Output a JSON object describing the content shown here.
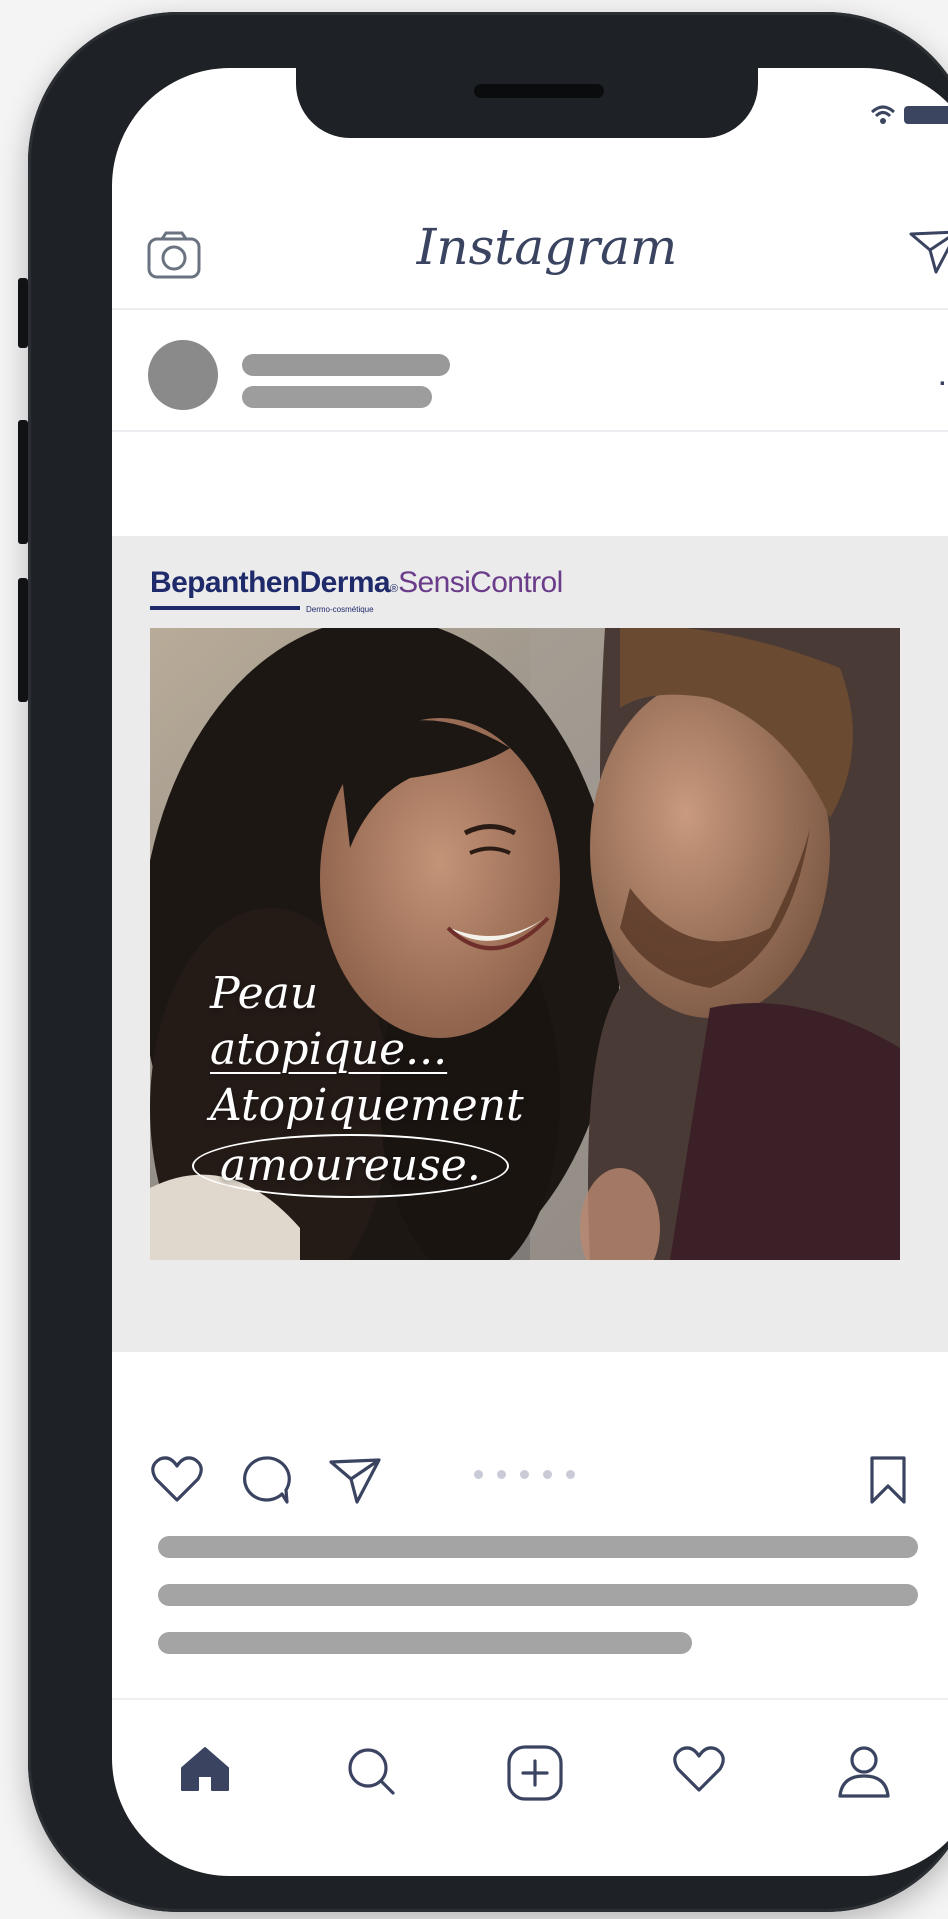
{
  "status_bar": {
    "icons": [
      "wifi-icon",
      "battery-icon"
    ]
  },
  "header": {
    "title": "Instagram",
    "left_icon": "camera-icon",
    "right_icon": "send-icon"
  },
  "post": {
    "menu_label": "...",
    "ad": {
      "brand_main": "BepanthenDerma",
      "brand_registered": "®",
      "brand_sub": "SensiControl",
      "brand_tag": "Dermo-cosmétique",
      "tagline": [
        "Peau",
        "atopique...",
        "Atopiquement",
        "amoureuse."
      ]
    }
  },
  "actions": {
    "icons": [
      "heart-icon",
      "comment-icon",
      "share-icon",
      "bookmark-icon"
    ],
    "carousel_dots": 5
  },
  "tabbar": {
    "items": [
      "home-icon",
      "search-icon",
      "add-post-icon",
      "activity-heart-icon",
      "profile-icon"
    ]
  },
  "colors": {
    "ink": "#3a4461",
    "brand_blue": "#1f2a6b",
    "brand_purple": "#6a3c8a",
    "phone_frame": "#1e2125",
    "skeleton": "#a4a4a4"
  }
}
